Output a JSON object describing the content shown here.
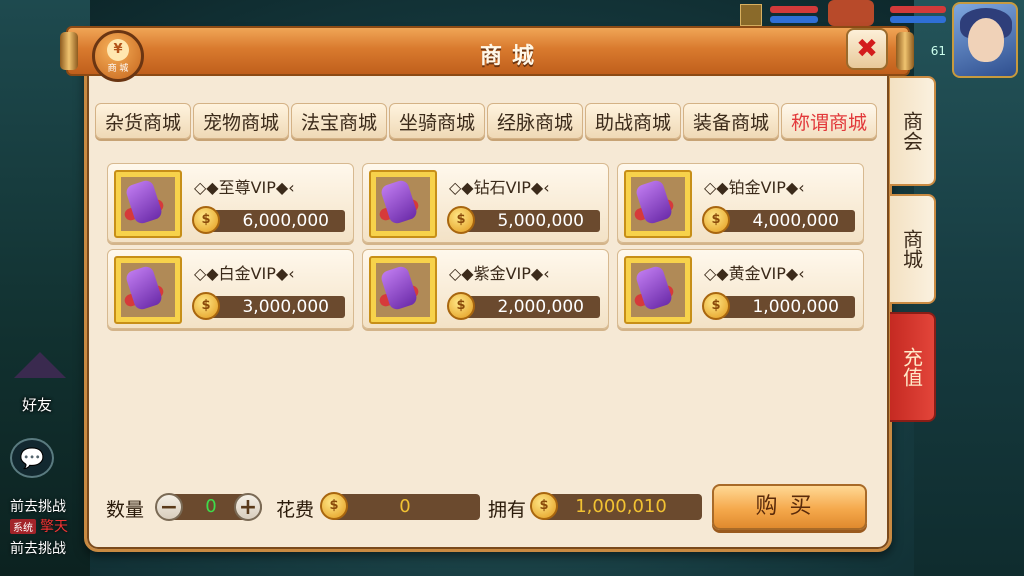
{
  "title": "商城",
  "badge": {
    "coin": "¥",
    "label": "商 城"
  },
  "close_icon": "✖",
  "tabs": [
    {
      "label": "杂货商城",
      "active": false
    },
    {
      "label": "宠物商城",
      "active": false
    },
    {
      "label": "法宝商城",
      "active": false
    },
    {
      "label": "坐骑商城",
      "active": false
    },
    {
      "label": "经脉商城",
      "active": false
    },
    {
      "label": "助战商城",
      "active": false
    },
    {
      "label": "装备商城",
      "active": false
    },
    {
      "label": "称谓商城",
      "active": true
    }
  ],
  "items": [
    {
      "name": "◇◆至尊VIP◆‹",
      "price": "6,000,000"
    },
    {
      "name": "◇◆钻石VIP◆‹",
      "price": "5,000,000"
    },
    {
      "name": "◇◆铂金VIP◆‹",
      "price": "4,000,000"
    },
    {
      "name": "◇◆白金VIP◆‹",
      "price": "3,000,000"
    },
    {
      "name": "◇◆紫金VIP◆‹",
      "price": "2,000,000"
    },
    {
      "name": "◇◆黄金VIP◆‹",
      "price": "1,000,000"
    }
  ],
  "bottom": {
    "qty_label": "数量",
    "qty_value": "0",
    "minus": "−",
    "plus": "+",
    "cost_label": "花费",
    "cost_value": "0",
    "own_label": "拥有",
    "own_value": "1,000,010",
    "buy_label": "购买"
  },
  "side_tabs": {
    "guild": "商会",
    "shop": "商城",
    "recharge": "充值"
  },
  "hud": {
    "level": "61"
  },
  "left": {
    "friend_label": "好友",
    "chat_icon": "💬",
    "chat_lines": [
      "前去挑战",
      "前去挑战"
    ],
    "chat_tag": "系统",
    "chat_tail": "擎天"
  },
  "colors": {
    "accent": "#d97a2e",
    "active_tab": "#e2393b",
    "qty_green": "#3edc4a",
    "gold": "#f2c232"
  }
}
